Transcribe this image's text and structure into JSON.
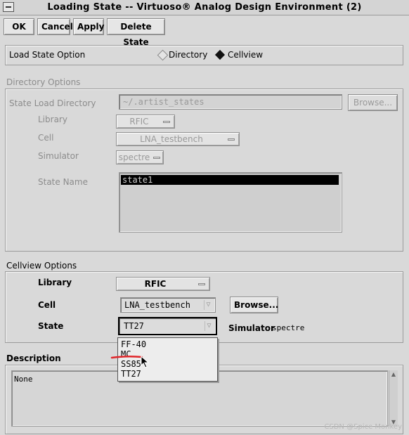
{
  "window": {
    "title": "Loading State -- Virtuoso® Analog Design Environment (2)"
  },
  "toolbar": {
    "ok": "OK",
    "cancel": "Cancel",
    "apply": "Apply",
    "delete_state": "Delete State"
  },
  "load_option": {
    "label": "Load State Option",
    "directory": "Directory",
    "cellview": "Cellview",
    "selected": "Cellview"
  },
  "directory_options": {
    "header": "Directory Options",
    "state_load_directory_label": "State Load Directory",
    "state_load_directory_value": "~/.artist_states",
    "browse": "Browse...",
    "library_label": "Library",
    "library_value": "RFIC",
    "cell_label": "Cell",
    "cell_value": "LNA_testbench",
    "simulator_label": "Simulator",
    "simulator_value": "spectre",
    "state_name_label": "State Name",
    "state_name_items": [
      "state1"
    ]
  },
  "cellview_options": {
    "header": "Cellview Options",
    "library_label": "Library",
    "library_value": "RFIC",
    "cell_label": "Cell",
    "cell_value": "LNA_testbench",
    "browse": "Browse...",
    "state_label": "State",
    "state_value": "TT27",
    "simulator_label": "Simulator",
    "simulator_value": "spectre",
    "state_options": [
      "FF-40",
      "MC",
      "SS85",
      "TT27"
    ]
  },
  "description": {
    "header": "Description",
    "value": "None"
  },
  "watermark": "CSDN @Spice Monkey"
}
